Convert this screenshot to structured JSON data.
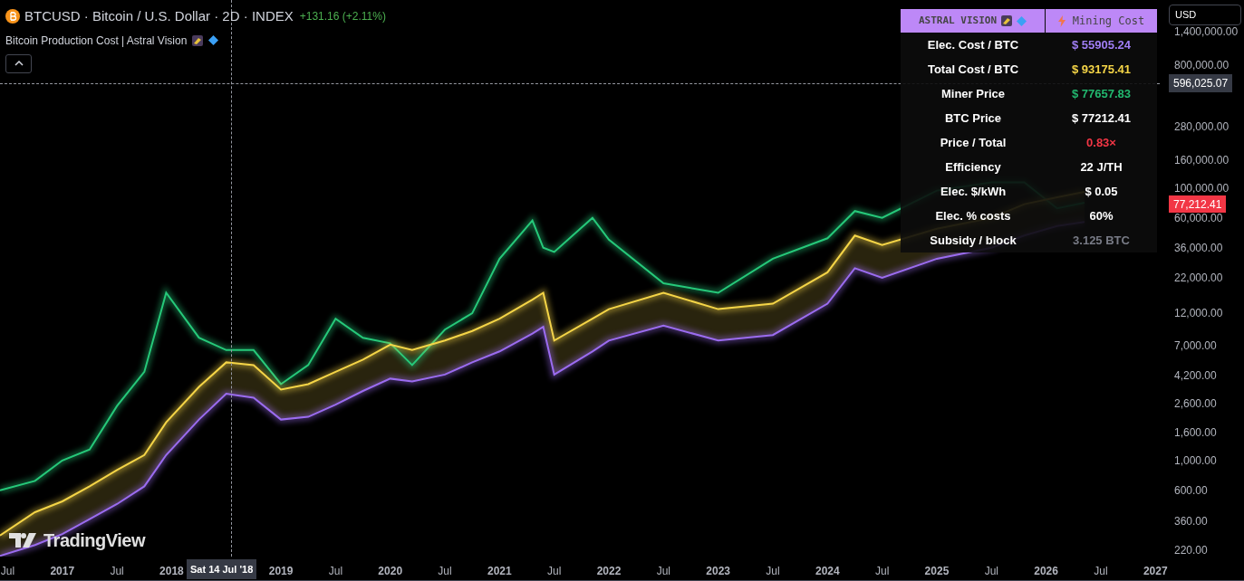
{
  "header": {
    "symbol": "BTCUSD · Bitcoin / U.S. Dollar · 2D · INDEX",
    "change": "+131.16 (+2.11%)"
  },
  "indicator": {
    "name": "Bitcoin Production Cost | Astral Vision"
  },
  "currency_button": "USD",
  "table": {
    "header": [
      "ASTRAL VISION",
      "Mining Cost"
    ],
    "rows": [
      {
        "label": "Elec. Cost / BTC",
        "value": "$ 55905.24",
        "color": "#a07ef5"
      },
      {
        "label": "Total Cost / BTC",
        "value": "$ 93175.41",
        "color": "#f5d547"
      },
      {
        "label": "Miner Price",
        "value": "$ 77657.83",
        "color": "#22b86f"
      },
      {
        "label": "BTC Price",
        "value": "$ 77212.41",
        "color": "#ffffff"
      },
      {
        "label": "Price / Total",
        "value": "0.83×",
        "color": "#f23645"
      },
      {
        "label": "Efficiency",
        "value": "22 J/TH",
        "color": "#ffffff"
      },
      {
        "label": "Elec. $/kWh",
        "value": "$ 0.05",
        "color": "#ffffff"
      },
      {
        "label": "Elec. % costs",
        "value": "60%",
        "color": "#ffffff"
      },
      {
        "label": "Subsidy / block",
        "value": "3.125 BTC",
        "color": "#787b86"
      }
    ]
  },
  "crosshair": {
    "price": "596,025.07",
    "date": "Sat 14 Jul '18"
  },
  "last_price": "77,212.41",
  "brand": "TradingView",
  "price_axis": [
    "1,400,000.00",
    "800,000.00",
    "280,000.00",
    "160,000.00",
    "100,000.00",
    "60,000.00",
    "36,000.00",
    "22,000.00",
    "12,000.00",
    "7,000.00",
    "4,200.00",
    "2,600.00",
    "1,600.00",
    "1,000.00",
    "600.00",
    "360.00",
    "220.00"
  ],
  "time_axis": [
    "Jul",
    "2017",
    "Jul",
    "2018",
    "2019",
    "Jul",
    "2020",
    "Jul",
    "2021",
    "Jul",
    "2022",
    "Jul",
    "2023",
    "Jul",
    "2024",
    "Jul",
    "2025",
    "Jul",
    "2026",
    "Jul",
    "2027"
  ]
}
